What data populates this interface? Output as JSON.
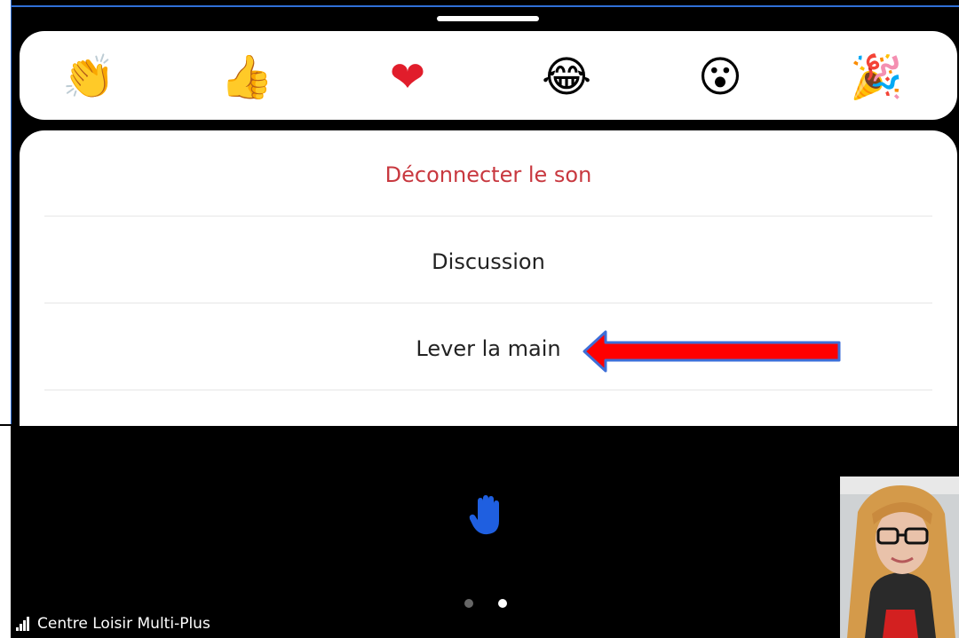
{
  "reactions": [
    {
      "icon": "clapping-hands-icon",
      "glyph": "👏"
    },
    {
      "icon": "thumbs-up-icon",
      "glyph": "👍"
    },
    {
      "icon": "heart-icon",
      "glyph": "❤"
    },
    {
      "icon": "tears-of-joy-icon",
      "glyph": "😂"
    },
    {
      "icon": "open-mouth-icon",
      "glyph": "😮"
    },
    {
      "icon": "party-popper-icon",
      "glyph": "🎉"
    }
  ],
  "menu": {
    "items": [
      {
        "label": "Déconnecter le son",
        "style": "danger"
      },
      {
        "label": "Discussion",
        "style": "normal"
      },
      {
        "label": "Lever la main",
        "style": "normal"
      }
    ]
  },
  "status": {
    "meeting_name": "Centre Loisir Multi-Plus"
  },
  "pagination": {
    "current": 2,
    "total": 2
  },
  "colors": {
    "danger": "#c8383f",
    "accent_blue": "#1f5fe0",
    "arrow_red": "#ff0000",
    "arrow_outline": "#3d6fd8"
  }
}
